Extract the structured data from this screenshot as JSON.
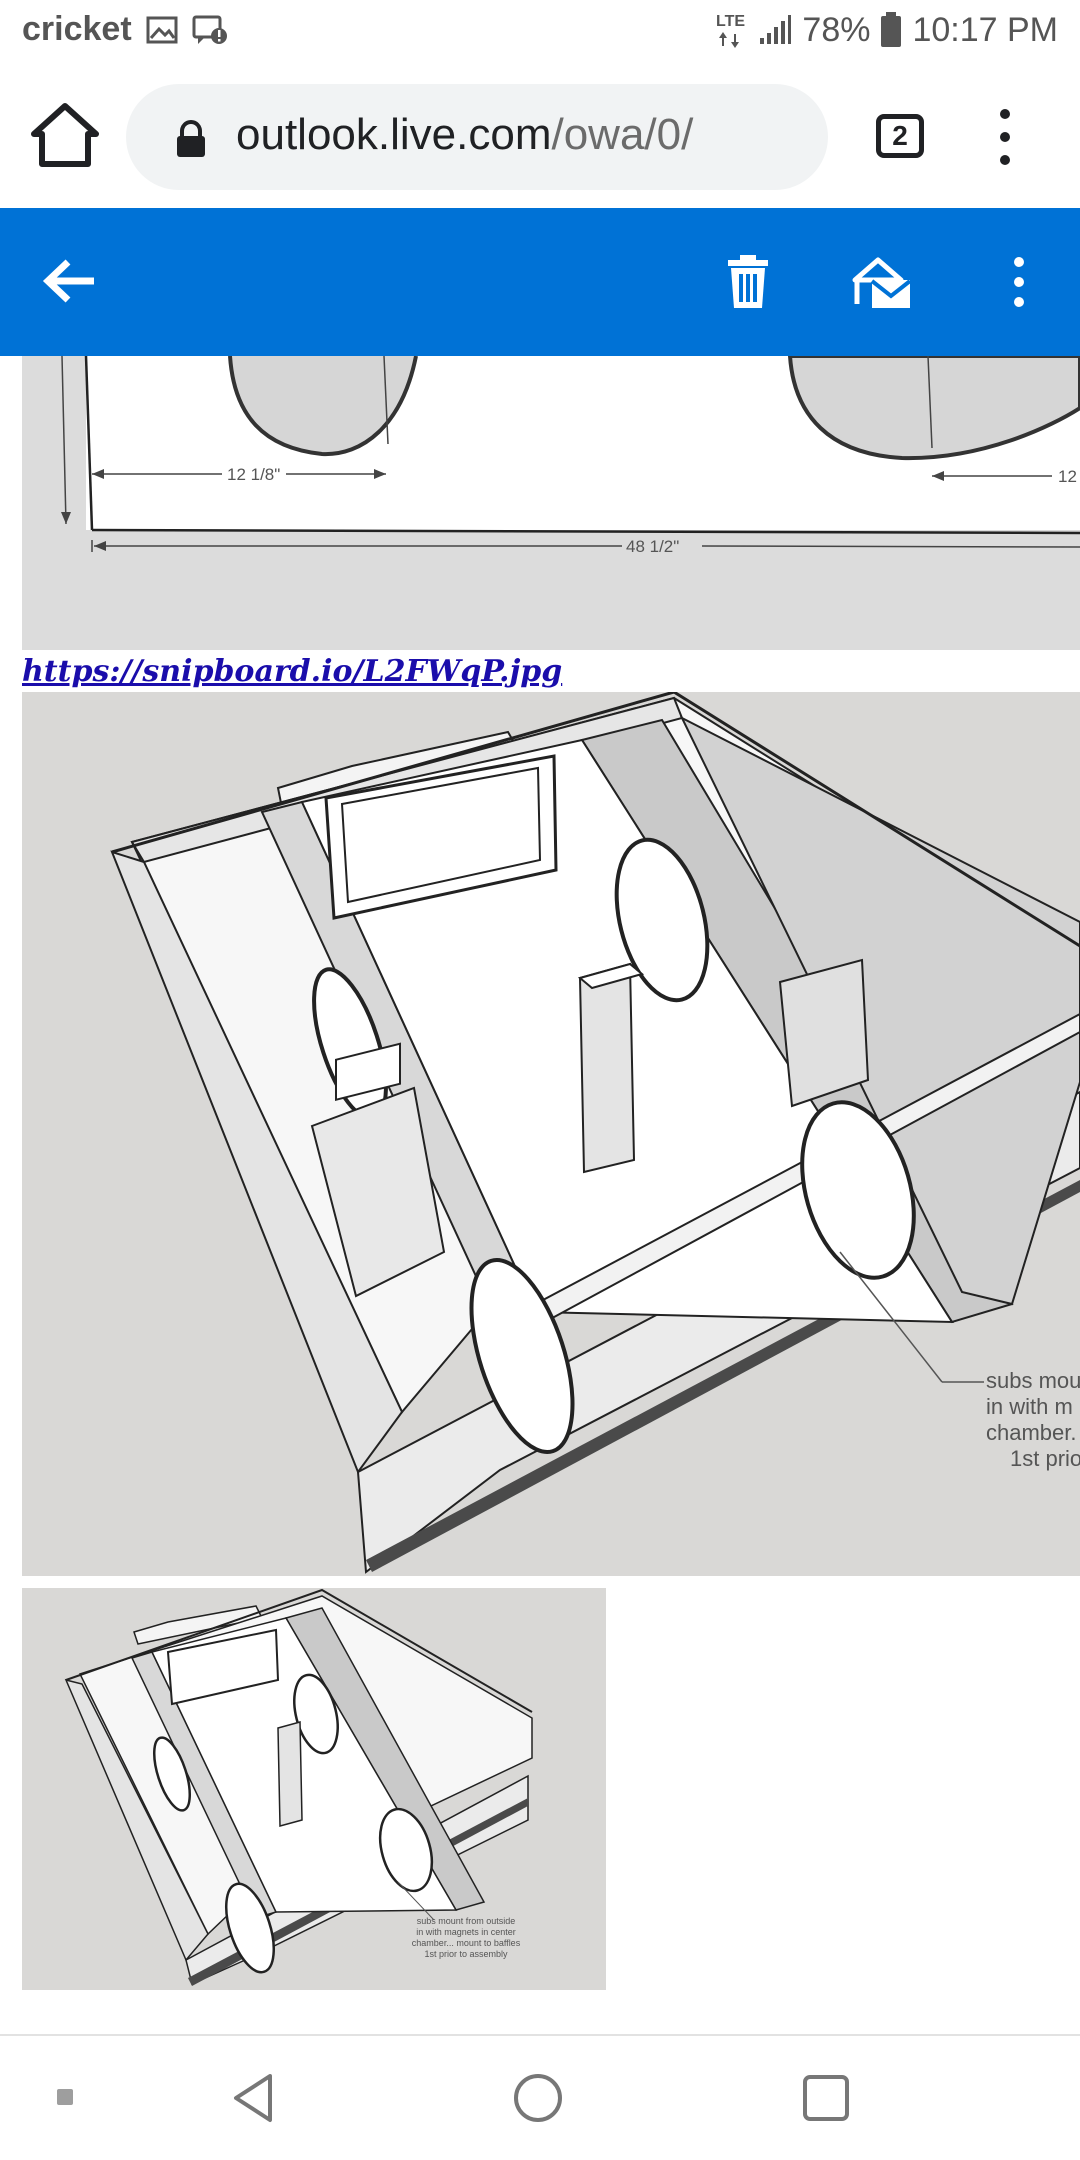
{
  "status_bar": {
    "carrier": "cricket",
    "network": "LTE",
    "battery": "78%",
    "time": "10:17 PM"
  },
  "browser": {
    "url_host": "outlook.live.com",
    "url_path": "/owa/0/",
    "tab_count": "2"
  },
  "email": {
    "link_text": "https://snipboard.io/L2FWqP.jpg",
    "drawing1": {
      "dim_left": "12 1/8\"",
      "dim_right": "12",
      "dim_width": "48 1/2\""
    },
    "drawing2": {
      "note_lines": [
        "subs mou",
        "in with m",
        "chamber.",
        "1st prio"
      ]
    },
    "drawing3": {
      "note_lines": [
        "subs mount from outside",
        "in with magnets in center",
        "chamber... mount to baffles",
        "1st prior to assembly"
      ]
    }
  },
  "colors": {
    "app_bar": "#0072d6",
    "link": "#1a0dab"
  }
}
